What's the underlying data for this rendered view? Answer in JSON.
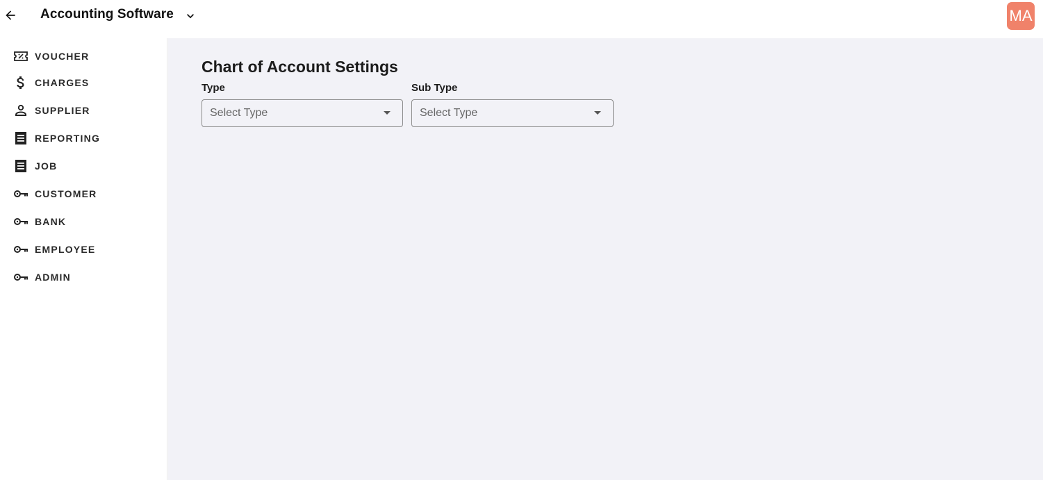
{
  "header": {
    "title": "Accounting Software",
    "back_icon": "arrow-left-icon",
    "switch_icon": "chevron-down-icon",
    "avatar_initials": "MA",
    "avatar_color": "#f0826a"
  },
  "sidebar": {
    "items": [
      {
        "label": "VOUCHER",
        "icon": "ticket-icon"
      },
      {
        "label": "CHARGES",
        "icon": "dollar-icon"
      },
      {
        "label": "SUPPLIER",
        "icon": "person-icon"
      },
      {
        "label": "REPORTING",
        "icon": "receipt-icon"
      },
      {
        "label": "JOB",
        "icon": "receipt-icon"
      },
      {
        "label": "CUSTOMER",
        "icon": "key-icon"
      },
      {
        "label": "BANK",
        "icon": "key-icon"
      },
      {
        "label": "EMPLOYEE",
        "icon": "key-icon"
      },
      {
        "label": "ADMIN",
        "icon": "key-icon"
      }
    ]
  },
  "main": {
    "title": "Chart of Account Settings",
    "background": "#f2f2f7",
    "fields": [
      {
        "label": "Type",
        "placeholder": "Select Type"
      },
      {
        "label": "Sub Type",
        "placeholder": "Select Type"
      }
    ]
  }
}
